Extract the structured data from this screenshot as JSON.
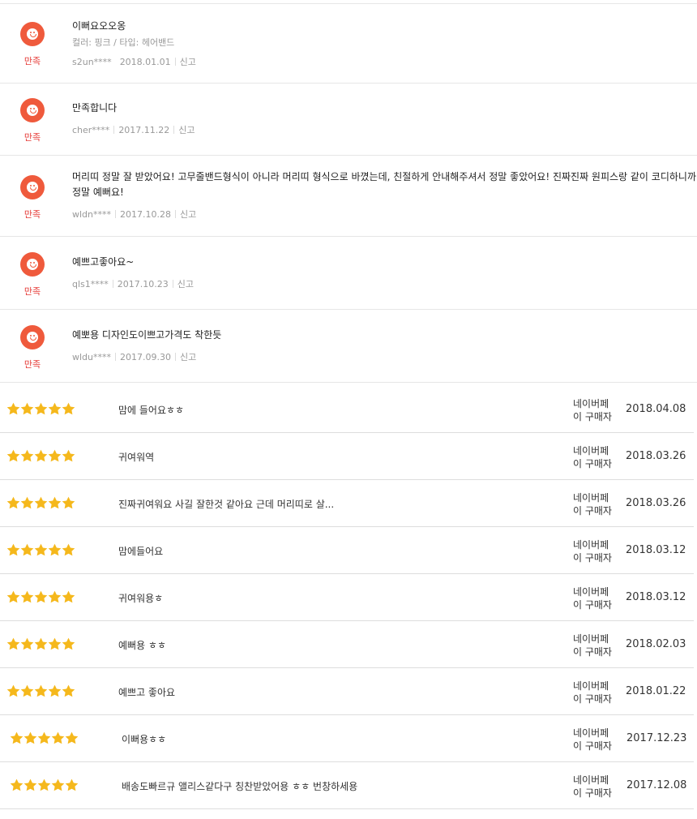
{
  "satisfaction_label": "만족",
  "report_label": "신고",
  "top_reviews": [
    {
      "text": "이뻐요오오옹",
      "option": "컬러: 핑크 / 타입: 헤어밴드",
      "user": "s2un****",
      "date": "2018.01.01"
    },
    {
      "text": "만족합니다",
      "option": "",
      "user": "cher****",
      "date": "2017.11.22"
    },
    {
      "text": "머리띠 정말 잘 받았어요! 고무줄밴드형식이 아니라 머리띠 형식으로 바꼈는데, 친절하게 안내해주셔서 정말 좋았어요! 진짜진짜 원피스랑 같이 코디하니까 정말 예뻐요!",
      "option": "",
      "user": "wldn****",
      "date": "2017.10.28"
    },
    {
      "text": "예쁘고좋아요~",
      "option": "",
      "user": "qls1****",
      "date": "2017.10.23"
    },
    {
      "text": "예뽀용 디자인도이쁘고가격도 착한듯",
      "option": "",
      "user": "wldu****",
      "date": "2017.09.30"
    }
  ],
  "list_reviews": [
    {
      "text": "맘에 들어요ㅎㅎ",
      "buyer_line1": "네이버페",
      "buyer_line2": "이 구매자",
      "date": "2018.04.08",
      "rating": 5
    },
    {
      "text": "귀여워역",
      "buyer_line1": "네이버페",
      "buyer_line2": "이 구매자",
      "date": "2018.03.26",
      "rating": 5
    },
    {
      "text": "진짜귀여워요 사길 잘한것 같아요 근데 머리띠로 살...",
      "buyer_line1": "네이버페",
      "buyer_line2": "이 구매자",
      "date": "2018.03.26",
      "rating": 5
    },
    {
      "text": "맘에들어요",
      "buyer_line1": "네이버페",
      "buyer_line2": "이 구매자",
      "date": "2018.03.12",
      "rating": 5
    },
    {
      "text": "귀여워용ㅎ",
      "buyer_line1": "네이버페",
      "buyer_line2": "이 구매자",
      "date": "2018.03.12",
      "rating": 5
    },
    {
      "text": "예뻐용 ㅎㅎ",
      "buyer_line1": "네이버페",
      "buyer_line2": "이 구매자",
      "date": "2018.02.03",
      "rating": 5
    },
    {
      "text": "예쁘고 좋아요",
      "buyer_line1": "네이버페",
      "buyer_line2": "이 구매자",
      "date": "2018.01.22",
      "rating": 5
    },
    {
      "text": "이뻐용ㅎㅎ",
      "buyer_line1": "네이버페",
      "buyer_line2": "이 구매자",
      "date": "2017.12.23",
      "rating": 5
    },
    {
      "text": "배송도빠르규 앨리스같다구 칭찬받았어용 ㅎㅎ 번창하세용",
      "buyer_line1": "네이버페",
      "buyer_line2": "이 구매자",
      "date": "2017.12.08",
      "rating": 5
    }
  ],
  "colors": {
    "avatar": "#ef5a3c",
    "satisfaction": "#e53935",
    "star": "#f5b81c"
  },
  "icons": {
    "avatar": "smiley-face-icon",
    "star": "star-icon"
  }
}
